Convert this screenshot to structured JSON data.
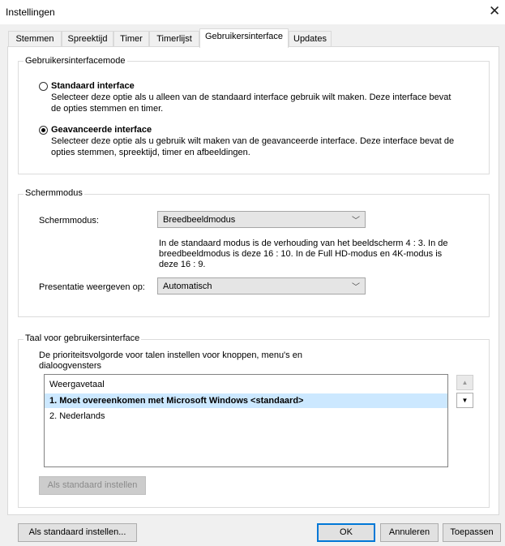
{
  "window": {
    "title": "Instellingen",
    "close_glyph": "✕"
  },
  "tabs": [
    {
      "label": "Stemmen"
    },
    {
      "label": "Spreektijd"
    },
    {
      "label": "Timer"
    },
    {
      "label": "Timerlijst"
    },
    {
      "label": "Gebruikersinterface"
    },
    {
      "label": "Updates"
    }
  ],
  "active_tab": "Gebruikersinterface",
  "mode_group": {
    "legend": "Gebruikersinterfacemode",
    "standard": {
      "label": "Standaard interface",
      "desc1": "Selecteer deze optie als u alleen van de standaard interface gebruik wilt maken. Deze interface bevat",
      "desc2": "de opties stemmen en timer.",
      "checked": false
    },
    "advanced": {
      "label": "Geavanceerde interface",
      "desc1": "Selecteer deze optie als u gebruik wilt maken van de geavanceerde interface. Deze interface bevat de",
      "desc2": "opties stemmen, spreektijd, timer en afbeeldingen.",
      "checked": true
    }
  },
  "screen_group": {
    "legend": "Schermmodus",
    "mode_label": "Schermmodus:",
    "mode_value": "Breedbeeldmodus",
    "info1": "In de standaard modus is de verhouding van het beeldscherm 4 : 3. In de",
    "info2": "breedbeeldmodus is deze 16 : 10. In de Full HD-modus en 4K-modus is",
    "info3": "deze 16 : 9.",
    "present_label": "Presentatie weergeven op:",
    "present_value": "Automatisch",
    "chevron": "﹀"
  },
  "lang_group": {
    "legend": "Taal voor gebruikersinterface",
    "desc1": "De prioriteitsvolgorde voor talen instellen voor knoppen, menu's en",
    "desc2": "dialoogvensters",
    "header": "Weergavetaal",
    "items": [
      {
        "label": "1.  Moet overeenkomen met Microsoft Windows <standaard>"
      },
      {
        "label": "2.  Nederlands"
      }
    ],
    "up_glyph": "▲",
    "down_glyph": "▼",
    "set_default": "Als standaard instellen"
  },
  "footer": {
    "set_default": "Als standaard instellen...",
    "ok": "OK",
    "cancel": "Annuleren",
    "apply": "Toepassen"
  }
}
